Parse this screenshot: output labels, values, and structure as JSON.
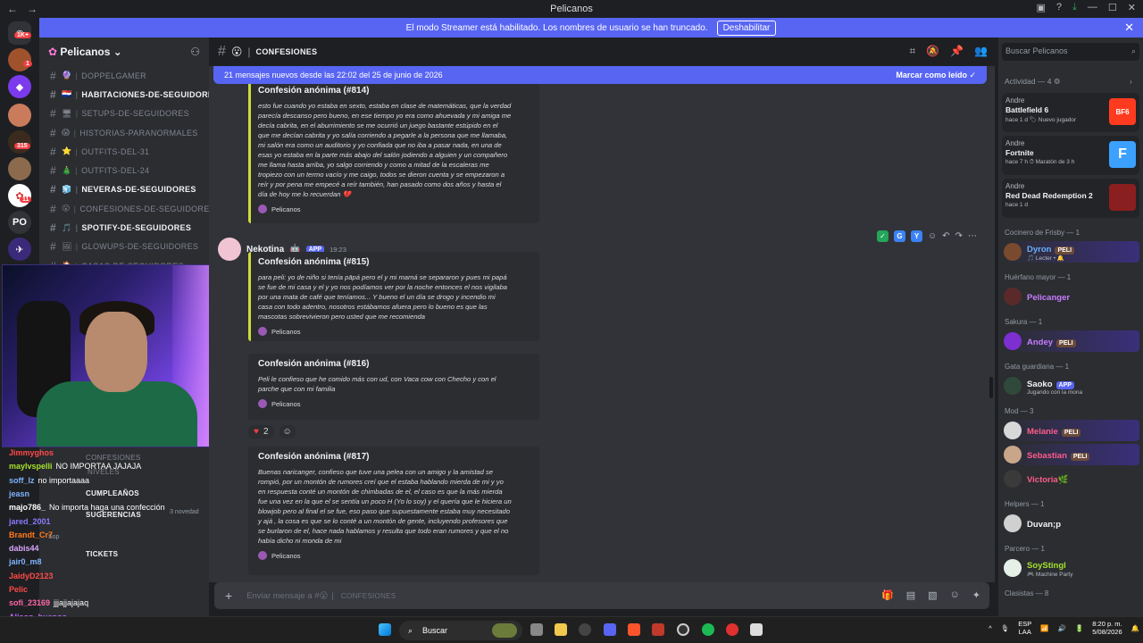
{
  "window": {
    "title": "Pelicanos"
  },
  "banner": {
    "text": "El modo Streamer está habilitado. Los nombres de usuario se han truncado.",
    "button": "Deshabilitar"
  },
  "server_rail": {
    "badges": [
      "1K+",
      "1",
      "315",
      "11"
    ],
    "initials": "PO"
  },
  "server": {
    "name": "Pelicanos"
  },
  "channels": [
    {
      "emoji": "🔮",
      "name": "doppelgamer",
      "bold": false
    },
    {
      "emoji": "🇵🇾",
      "name": "habitaciones-de-seguidores",
      "bold": true
    },
    {
      "emoji": "🖥",
      "name": "setups-de-seguidores",
      "bold": false
    },
    {
      "emoji": "😱",
      "name": "historias-paranormales",
      "bold": false
    },
    {
      "emoji": "⭐",
      "name": "outfits-del-31",
      "bold": false
    },
    {
      "emoji": "🎄",
      "name": "outfits-del-24",
      "bold": false
    },
    {
      "emoji": "🧊",
      "name": "neveras-de-seguidores",
      "bold": true
    },
    {
      "emoji": "😮",
      "name": "confesiones-de-seguidores",
      "bold": false
    },
    {
      "emoji": "🎵",
      "name": "spotify-de-seguidores",
      "bold": true
    },
    {
      "emoji": "🖼",
      "name": "glowups-de-seguidores",
      "bold": false
    },
    {
      "emoji": "🏠",
      "name": "casas-de-seguidores",
      "bold": false
    }
  ],
  "overlay_channels": [
    {
      "name": "confesiones",
      "bold": false
    },
    {
      "name": "niveles",
      "bold": false
    },
    {
      "name": "cumpleaños",
      "bold": true
    },
    {
      "name": "sugerencias",
      "bold": true
    },
    {
      "name": "tickets",
      "bold": true
    }
  ],
  "overlay_meta": {
    "novedad": "3 novedad",
    "soporte": "Sop"
  },
  "stream_chat": [
    {
      "user": "Jimmyghos",
      "msg": "",
      "color": "#ff4a4a"
    },
    {
      "user": "maylvspelli",
      "msg": "NO IMPORTAA JAJAJA",
      "color": "#a6e22e"
    },
    {
      "user": "soff_lz",
      "msg": "no importaaaa",
      "color": "#7fb4ff"
    },
    {
      "user": "jeasn",
      "msg": "",
      "color": "#7fb4ff"
    },
    {
      "user": "majo786_",
      "msg": "No importa haga una confección",
      "color": "#ffffff"
    },
    {
      "user": "jared_2001",
      "msg": "",
      "color": "#8a7bff"
    },
    {
      "user": "Brandt_Cr7",
      "msg": "",
      "color": "#ff7a1a"
    },
    {
      "user": "dabis44",
      "msg": "",
      "color": "#d9a6ff"
    },
    {
      "user": "jair0_m8",
      "msg": "",
      "color": "#7fb4ff"
    },
    {
      "user": "JaidyD2123",
      "msg": "",
      "color": "#ff4a4a"
    },
    {
      "user": "Pelic",
      "msg": "",
      "color": "#ff4a4a"
    },
    {
      "user": "sofi_23169",
      "msg": "jjjajjajajaq",
      "color": "#ff66aa"
    },
    {
      "user": "Alison_buenoo",
      "msg": "",
      "color": "#c06bff"
    }
  ],
  "chat_header": {
    "emoji": "😮",
    "channel": "confesiones"
  },
  "new_messages": {
    "text": "21 mensajes nuevos desde las 22:02 del 25 de junio de 2026",
    "action": "Marcar como leído"
  },
  "messages": [
    {
      "title": "Confesión anónima (#814)",
      "body": "esto fue cuando yo estaba en sexto, estaba en clase de matemáticas, que la verdad\nparecía descanso pero bueno, en ese tiempo yo era como ahuevada y mi amiga me\ndecía cabrita, en el aburrimiento se me ocurrió un juego bastante estúpido en el\nque me decían cabrita y yo salía corriendo a pegarle a la persona que me llamaba,\nmi salón era como un auditorio y yo confiada que no iba a pasar nada, en una de\nesas yo estaba en la parte más abajo del salón jodiendo a alguien y un compañero\nme llama hasta arriba, yo salgo corriendo y como a mitad de la escaleras me\ntropiezo con un termo vacío y me caigo, todos se dieron cuenta y se empezaron a\nreír y por pena me empecé a reír también, han pasado como dos años y hasta el\ndía de hoy me lo recuerdan 💔",
      "footer": "Pelicanos"
    },
    {
      "title": "Confesión anónima (#815)",
      "body": "para peli: yo de niño si tenía pāpá pero el y mi mamá se separaron y pues mi papá\nse fue de mi casa y el y yo nos podíamos ver por la noche entonces el nos vigilaba\npor una mata de café que teníamos... Y bueno el un día se drogo y incendio mi\ncasa con todo adentro, nosotros estábamos afuera pero lo bueno es que las\nmascotas sobrevivieron pero usted que me recomienda",
      "footer": "Pelicanos"
    },
    {
      "title": "Confesión anónima (#816)",
      "body": "Peli le confieso que he comido más con ud, con Vaca cow con Checho y con el\nparche que con mi familia",
      "footer": "Pelicanos"
    },
    {
      "title": "Confesión anónima (#817)",
      "body": "Buenas naricanger, confieso que tuve una pelea con un amigo y la amistad se\nrompió, por un montón de rumores creí que el estaba hablando mierda de mi y yo\nen respuesta conté un montón de chimbadas de el, el caso es que la más mierda\nfue una vez en la que el se sentía un poco H (Yo lo soy) y el quería que le hiciera un\nblowjob pero al final el se fue, eso paso que supuestamente estaba muy necesitado\ny ajá , la cosa es que se lo conté a un montón de gente, incluyendo profesores que\nse burlaron de el, hace nada hablamos y resulta que todo eran rumores y que el no\nhabía dicho ni monda de mi",
      "footer": "Pelicanos"
    }
  ],
  "author": {
    "name": "Nekotina",
    "tag": "APP",
    "time": "19:23"
  },
  "reaction": {
    "count": "2"
  },
  "action_keys": [
    "G",
    "Y"
  ],
  "composer": {
    "placeholder": "Enviar mensaje a #",
    "channel": "confesiones"
  },
  "members": {
    "search_placeholder": "Buscar Pelicanos",
    "activity_header": "Actividad — 4",
    "activities": [
      {
        "who": "Andre",
        "game": "Battlefield 6",
        "meta": "hace 1 d   🏷 Nuevo jugador",
        "icon": "BF6"
      },
      {
        "who": "Andre",
        "game": "Fortnite",
        "meta": "hace 7 h   ⏱ Maratón de 3 h",
        "icon": "F"
      },
      {
        "who": "Andre",
        "game": "Red Dead Redemption 2",
        "meta": "hace 1 d",
        "icon": ""
      }
    ],
    "groups": [
      {
        "role": "Cocinero de Frisby — 1",
        "members": [
          {
            "name": "Dyron",
            "sub": "🎵 Lecter • 🔔",
            "tag": "PELI",
            "color": "#6ab0ff"
          }
        ]
      },
      {
        "role": "Huérfano mayor — 1",
        "members": [
          {
            "name": "Pelicanger",
            "sub": "",
            "tag": "",
            "color": "#c77dff"
          }
        ]
      },
      {
        "role": "Sakura — 1",
        "members": [
          {
            "name": "Andey",
            "sub": "",
            "tag": "PELI",
            "color": "#c77dff"
          }
        ]
      },
      {
        "role": "Gata guardiana — 1",
        "members": [
          {
            "name": "Saoko",
            "sub": "Jugando con la mona",
            "tag": "APP",
            "color": "#f2f3f5"
          }
        ]
      },
      {
        "role": "Mod — 3",
        "members": [
          {
            "name": "Melanie",
            "sub": "",
            "tag": "PELI",
            "color": "#ff5c8a"
          },
          {
            "name": "Sebastian",
            "sub": "",
            "tag": "PELI",
            "color": "#ff5c8a"
          },
          {
            "name": "Victoria🌿",
            "sub": "",
            "tag": "",
            "color": "#ff5c8a"
          }
        ]
      },
      {
        "role": "Helpers — 1",
        "members": [
          {
            "name": "Duvan;p",
            "sub": "",
            "tag": "",
            "color": "#f2f3f5"
          }
        ]
      },
      {
        "role": "Parcero — 1",
        "members": [
          {
            "name": "SoyStingl",
            "sub": "🎮 Machine Party",
            "tag": "",
            "color": "#a6e22e"
          }
        ]
      },
      {
        "role": "Clasistas — 8",
        "members": []
      }
    ]
  },
  "taskbar": {
    "search": "Buscar",
    "lang": "ESP\nLAA",
    "time": "8:20 p. m.",
    "date": "5/08/2026"
  },
  "colors": {
    "accent": "#5865f2",
    "embed_border": "#cddc39",
    "bg": "#313338"
  }
}
